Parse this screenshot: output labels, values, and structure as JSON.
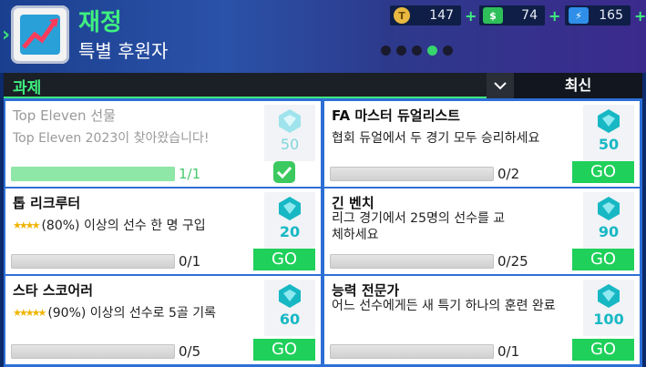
{
  "header": {
    "title": "재정",
    "subtitle": "특별 후원자",
    "page_dots": {
      "count": 5,
      "active_index": 3
    }
  },
  "currencies": [
    {
      "name": "tokens",
      "icon": "T",
      "value": "147",
      "color": "#e8b840"
    },
    {
      "name": "cash",
      "icon": "cash-icon",
      "value": "74",
      "color": "#2fbf5a"
    },
    {
      "name": "energy",
      "icon": "lightning-icon",
      "value": "165",
      "color": "#2f8fe8"
    }
  ],
  "plus_label": "+",
  "tabs": {
    "active": "과제",
    "sort": "최신"
  },
  "tasks": [
    {
      "name": "Top Eleven 선물",
      "desc": "Top Eleven 2023이 찾아왔습니다!",
      "reward": "50",
      "progress": "1/1",
      "fill": 1.0,
      "done": true
    },
    {
      "name": "FA 마스터 듀얼리스트",
      "desc": "협회 듀얼에서 두 경기 모두 승리하세요",
      "reward": "50",
      "progress": "0/2",
      "fill": 0.0,
      "done": false
    },
    {
      "name": "톱 리크루터",
      "desc": "(80%) 이상의 선수 한 명 구입",
      "stars": "★★★★",
      "reward": "20",
      "progress": "0/1",
      "fill": 0.0,
      "done": false
    },
    {
      "name": "긴 벤치",
      "desc": "리그 경기에서 25명의 선수를 교체하세요",
      "reward": "90",
      "progress": "0/25",
      "fill": 0.0,
      "done": false
    },
    {
      "name": "스타 스코어러",
      "desc": "(90%) 이상의 선수로 5골 기록",
      "stars": "★★★★★",
      "reward": "60",
      "progress": "0/5",
      "fill": 0.0,
      "done": false
    },
    {
      "name": "능력 전문가",
      "desc": "어느 선수에게든 새 특기 하나의 훈련 완료",
      "reward": "100",
      "progress": "0/1",
      "fill": 0.0,
      "done": false
    }
  ],
  "go_label": "GO"
}
